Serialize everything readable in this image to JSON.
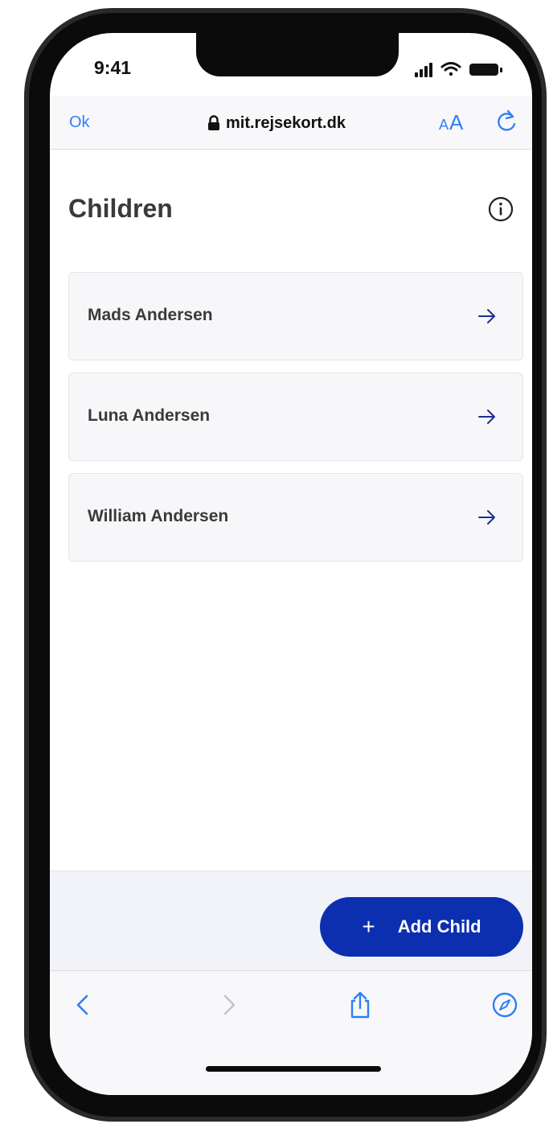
{
  "status_bar": {
    "time": "9:41",
    "icons": [
      "signal-icon",
      "wifi-icon",
      "battery-icon"
    ]
  },
  "browser": {
    "ok_label": "Ok",
    "url": "mit.rejsekort.dk",
    "text_size_small": "A",
    "text_size_large": "A",
    "icons": [
      "lock-icon",
      "reload-icon"
    ]
  },
  "page": {
    "title": "Children",
    "children": [
      {
        "name": "Mads Andersen"
      },
      {
        "name": "Luna Andersen"
      },
      {
        "name": "William Andersen"
      }
    ]
  },
  "footer": {
    "plus": "+",
    "add_child_label": "Add Child"
  },
  "toolbar": {
    "icons": [
      "back-icon",
      "forward-icon",
      "share-icon",
      "compass-icon"
    ]
  },
  "colors": {
    "accent_blue": "#2f7ff5",
    "primary_button": "#0c2fb0",
    "arrow_color": "#1f2f8f",
    "text_dark": "#3a3a3a"
  }
}
